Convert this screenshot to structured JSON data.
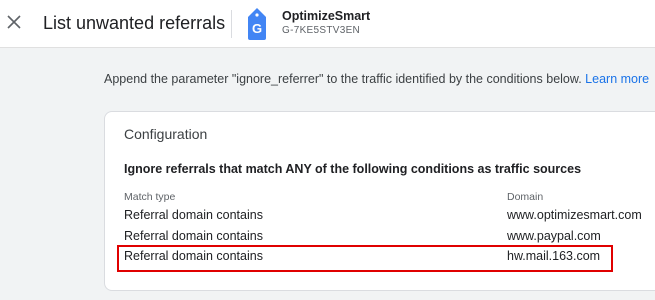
{
  "header": {
    "title": "List unwanted referrals",
    "property_name": "OptimizeSmart",
    "property_id": "G-7KE5STV3EN",
    "icon": "close-icon",
    "tag_icon": "gtag-icon",
    "tag_letter": "G",
    "tag_color": "#4285f4"
  },
  "description": {
    "text": "Append the parameter \"ignore_referrer\" to the traffic identified by the conditions below.",
    "link_label": "Learn more",
    "link_color": "#1a73e8"
  },
  "configuration": {
    "title": "Configuration",
    "heading": "Ignore referrals that match ANY of the following conditions as traffic sources",
    "columns": [
      "Match type",
      "Domain"
    ],
    "rows": [
      {
        "match_type": "Referral domain contains",
        "domain": "www.optimizesmart.com"
      },
      {
        "match_type": "Referral domain contains",
        "domain": "www.paypal.com"
      },
      {
        "match_type": "Referral domain contains",
        "domain": "hw.mail.163.com"
      }
    ],
    "highlight_color": "#e00000"
  }
}
